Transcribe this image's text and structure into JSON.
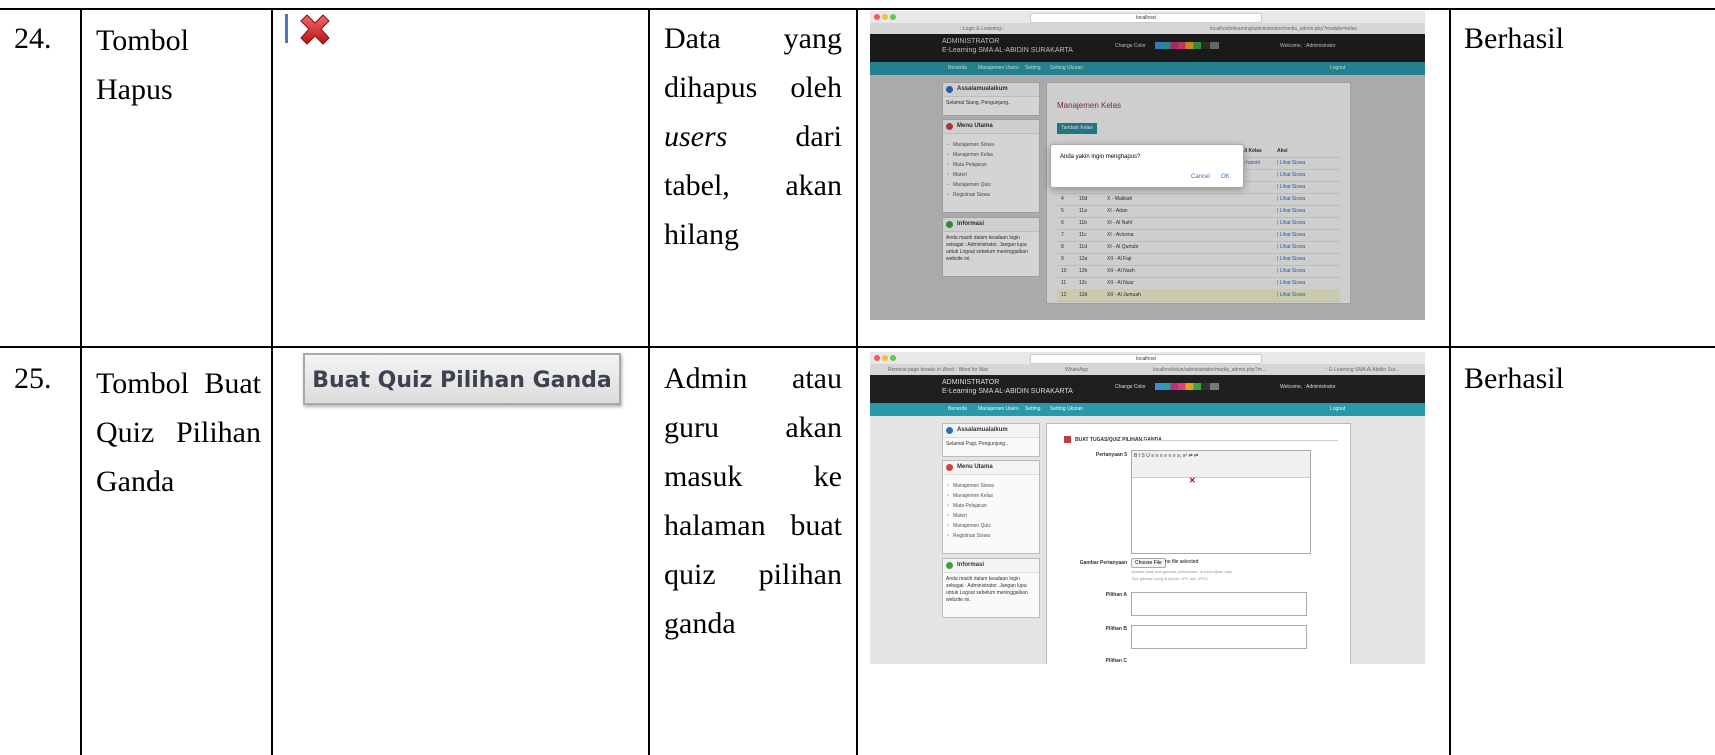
{
  "rows": [
    {
      "number": "24.",
      "name_lines": [
        "Tombol",
        "Hapus"
      ],
      "icon": "delete-x-icon",
      "result_lines": [
        "Data yang",
        "dihapus oleh",
        "users dari",
        "tabel, akan",
        "hilang"
      ],
      "status": "Berhasil",
      "screenshot": {
        "tab_title": "::Login E-Learning::",
        "address": "localhost",
        "url": "localhost/elearning/administrator/media_admin.php?module=kelas",
        "header_line1": "ADMINISTRATOR",
        "header_line2": "E-Learning SMA AL-ABIDIN SURAKARTA",
        "change_color": "Change Color",
        "welcome": "Welcome, : Administrator",
        "nav": [
          "Beranda",
          "Manajemen Users",
          "Setting",
          "Setting Ukuran",
          "Logout"
        ],
        "side_greeting_title": "Assalamualaikum",
        "side_greeting_text": "Selamat Siang, Pengunjung..",
        "menu_title": "Menu Utama",
        "menu_items": [
          "Manajemen Siswa",
          "Manajemen Kelas",
          "Mata Pelajaran",
          "Materi",
          "Manajemen Quiz",
          "Registrasi Siswa"
        ],
        "info_title": "Informasi",
        "info_text": "Anda masih dalam keadaan login sebagai : Administrator. Jangan lupa untuk Logout sebelum meninggalkan website ini.",
        "panel_title": "Manajemen Kelas",
        "add_button": "Tambah Kelas",
        "col_wali": "Wali Kelas",
        "col_aksi": "Aksi",
        "wali_visible": "o hamid",
        "action_text": "| Lihat Siswa",
        "table_rows": [
          [
            "4",
            "10d",
            "X - Makkah"
          ],
          [
            "5",
            "11a",
            "XI - Adan"
          ],
          [
            "6",
            "11b",
            "XI - Al Nahl"
          ],
          [
            "7",
            "11c",
            "XI - Avicena"
          ],
          [
            "8",
            "11d",
            "XI - Al Qurtubi"
          ],
          [
            "9",
            "12a",
            "XII - Al Fajr"
          ],
          [
            "10",
            "12b",
            "XII - Al Nash"
          ],
          [
            "11",
            "12c",
            "XII - Al Nuur"
          ],
          [
            "12",
            "12d",
            "XII - Al Jumuah"
          ]
        ],
        "dialog_text": "Anda yakin ingin menghapus?",
        "dialog_cancel": "Cancel",
        "dialog_ok": "OK"
      }
    },
    {
      "number": "25.",
      "name_lines": [
        "Tombol Buat",
        "Quiz Pilihan",
        "Ganda"
      ],
      "button_label": "Buat Quiz Pilihan Ganda",
      "result_lines": [
        "Admin atau",
        "guru akan",
        "masuk ke",
        "halaman buat",
        "quiz pilihan",
        "ganda"
      ],
      "status": "Berhasil",
      "screenshot": {
        "tab1": "Remove page breaks in Word - Word for Mac",
        "tab2": "WhatsApp",
        "tab3": "localhost/elun/administrator/media_admin.php?m...",
        "tab4": ":: E-Learning SMA Al Abidin Sur...",
        "address": "localhost",
        "header_line1": "ADMINISTRATOR",
        "header_line2": "E-Learning SMA AL-ABIDIN SURAKARTA",
        "change_color": "Change Color",
        "welcome": "Welcome, : Administrator",
        "nav": [
          "Beranda",
          "Manajemen Users",
          "Setting",
          "Setting Ukuran",
          "Logout"
        ],
        "side_greeting_title": "Assalamualaikum",
        "side_greeting_text": "Selamat Pagi, Pengunjung..",
        "menu_title": "Menu Utama",
        "menu_items": [
          "Manajemen Siswa",
          "Manajemen Kelas",
          "Mata Pelajaran",
          "Materi",
          "Manajemen Quiz",
          "Registrasi Siswa"
        ],
        "info_title": "Informasi",
        "info_text": "Anda masih dalam keadaan login sebagai : Administrator. Jangan lupa untuk Logout sebelum meninggalkan website ini.",
        "form_title": "BUAT TUGAS/QUIZ PILIHAN GANDA",
        "label_question": "Pertanyaan 5",
        "label_image": "Gambar Pertanyaan",
        "choose_file": "Choose File",
        "no_file": "no file selected",
        "image_hint1": "Apabila tidak ada gambar pertanyaan, di kosongkan saja",
        "image_hint2": "Tipe gambar yang di ijinkan JPG dan JPEG",
        "label_a": "Pilihan A",
        "label_b": "Pilihan B",
        "label_c": "Pilihan C"
      }
    }
  ]
}
